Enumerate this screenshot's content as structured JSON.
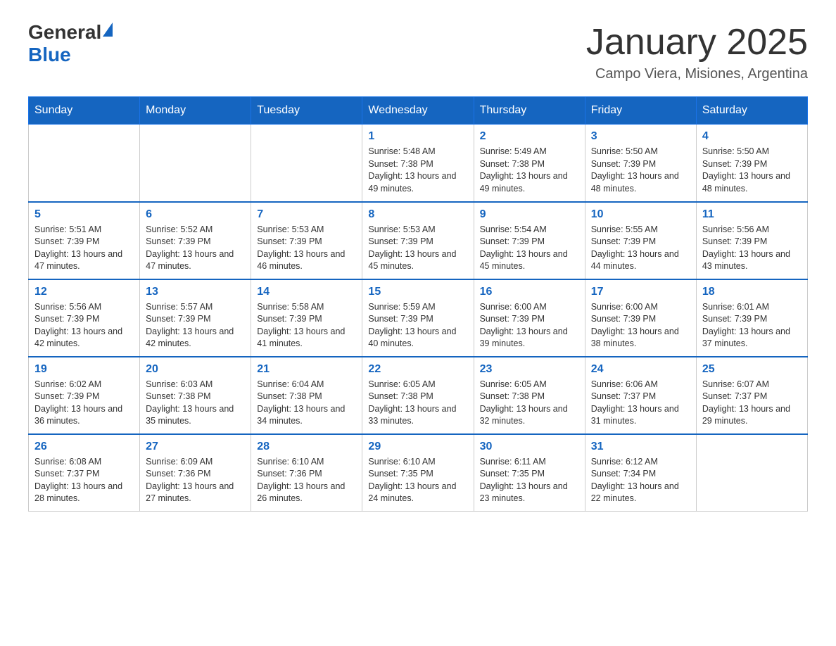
{
  "header": {
    "logo_general": "General",
    "logo_blue": "Blue",
    "month_title": "January 2025",
    "location": "Campo Viera, Misiones, Argentina"
  },
  "days_of_week": [
    "Sunday",
    "Monday",
    "Tuesday",
    "Wednesday",
    "Thursday",
    "Friday",
    "Saturday"
  ],
  "weeks": [
    [
      {
        "day": "",
        "info": ""
      },
      {
        "day": "",
        "info": ""
      },
      {
        "day": "",
        "info": ""
      },
      {
        "day": "1",
        "info": "Sunrise: 5:48 AM\nSunset: 7:38 PM\nDaylight: 13 hours and 49 minutes."
      },
      {
        "day": "2",
        "info": "Sunrise: 5:49 AM\nSunset: 7:38 PM\nDaylight: 13 hours and 49 minutes."
      },
      {
        "day": "3",
        "info": "Sunrise: 5:50 AM\nSunset: 7:39 PM\nDaylight: 13 hours and 48 minutes."
      },
      {
        "day": "4",
        "info": "Sunrise: 5:50 AM\nSunset: 7:39 PM\nDaylight: 13 hours and 48 minutes."
      }
    ],
    [
      {
        "day": "5",
        "info": "Sunrise: 5:51 AM\nSunset: 7:39 PM\nDaylight: 13 hours and 47 minutes."
      },
      {
        "day": "6",
        "info": "Sunrise: 5:52 AM\nSunset: 7:39 PM\nDaylight: 13 hours and 47 minutes."
      },
      {
        "day": "7",
        "info": "Sunrise: 5:53 AM\nSunset: 7:39 PM\nDaylight: 13 hours and 46 minutes."
      },
      {
        "day": "8",
        "info": "Sunrise: 5:53 AM\nSunset: 7:39 PM\nDaylight: 13 hours and 45 minutes."
      },
      {
        "day": "9",
        "info": "Sunrise: 5:54 AM\nSunset: 7:39 PM\nDaylight: 13 hours and 45 minutes."
      },
      {
        "day": "10",
        "info": "Sunrise: 5:55 AM\nSunset: 7:39 PM\nDaylight: 13 hours and 44 minutes."
      },
      {
        "day": "11",
        "info": "Sunrise: 5:56 AM\nSunset: 7:39 PM\nDaylight: 13 hours and 43 minutes."
      }
    ],
    [
      {
        "day": "12",
        "info": "Sunrise: 5:56 AM\nSunset: 7:39 PM\nDaylight: 13 hours and 42 minutes."
      },
      {
        "day": "13",
        "info": "Sunrise: 5:57 AM\nSunset: 7:39 PM\nDaylight: 13 hours and 42 minutes."
      },
      {
        "day": "14",
        "info": "Sunrise: 5:58 AM\nSunset: 7:39 PM\nDaylight: 13 hours and 41 minutes."
      },
      {
        "day": "15",
        "info": "Sunrise: 5:59 AM\nSunset: 7:39 PM\nDaylight: 13 hours and 40 minutes."
      },
      {
        "day": "16",
        "info": "Sunrise: 6:00 AM\nSunset: 7:39 PM\nDaylight: 13 hours and 39 minutes."
      },
      {
        "day": "17",
        "info": "Sunrise: 6:00 AM\nSunset: 7:39 PM\nDaylight: 13 hours and 38 minutes."
      },
      {
        "day": "18",
        "info": "Sunrise: 6:01 AM\nSunset: 7:39 PM\nDaylight: 13 hours and 37 minutes."
      }
    ],
    [
      {
        "day": "19",
        "info": "Sunrise: 6:02 AM\nSunset: 7:39 PM\nDaylight: 13 hours and 36 minutes."
      },
      {
        "day": "20",
        "info": "Sunrise: 6:03 AM\nSunset: 7:38 PM\nDaylight: 13 hours and 35 minutes."
      },
      {
        "day": "21",
        "info": "Sunrise: 6:04 AM\nSunset: 7:38 PM\nDaylight: 13 hours and 34 minutes."
      },
      {
        "day": "22",
        "info": "Sunrise: 6:05 AM\nSunset: 7:38 PM\nDaylight: 13 hours and 33 minutes."
      },
      {
        "day": "23",
        "info": "Sunrise: 6:05 AM\nSunset: 7:38 PM\nDaylight: 13 hours and 32 minutes."
      },
      {
        "day": "24",
        "info": "Sunrise: 6:06 AM\nSunset: 7:37 PM\nDaylight: 13 hours and 31 minutes."
      },
      {
        "day": "25",
        "info": "Sunrise: 6:07 AM\nSunset: 7:37 PM\nDaylight: 13 hours and 29 minutes."
      }
    ],
    [
      {
        "day": "26",
        "info": "Sunrise: 6:08 AM\nSunset: 7:37 PM\nDaylight: 13 hours and 28 minutes."
      },
      {
        "day": "27",
        "info": "Sunrise: 6:09 AM\nSunset: 7:36 PM\nDaylight: 13 hours and 27 minutes."
      },
      {
        "day": "28",
        "info": "Sunrise: 6:10 AM\nSunset: 7:36 PM\nDaylight: 13 hours and 26 minutes."
      },
      {
        "day": "29",
        "info": "Sunrise: 6:10 AM\nSunset: 7:35 PM\nDaylight: 13 hours and 24 minutes."
      },
      {
        "day": "30",
        "info": "Sunrise: 6:11 AM\nSunset: 7:35 PM\nDaylight: 13 hours and 23 minutes."
      },
      {
        "day": "31",
        "info": "Sunrise: 6:12 AM\nSunset: 7:34 PM\nDaylight: 13 hours and 22 minutes."
      },
      {
        "day": "",
        "info": ""
      }
    ]
  ]
}
